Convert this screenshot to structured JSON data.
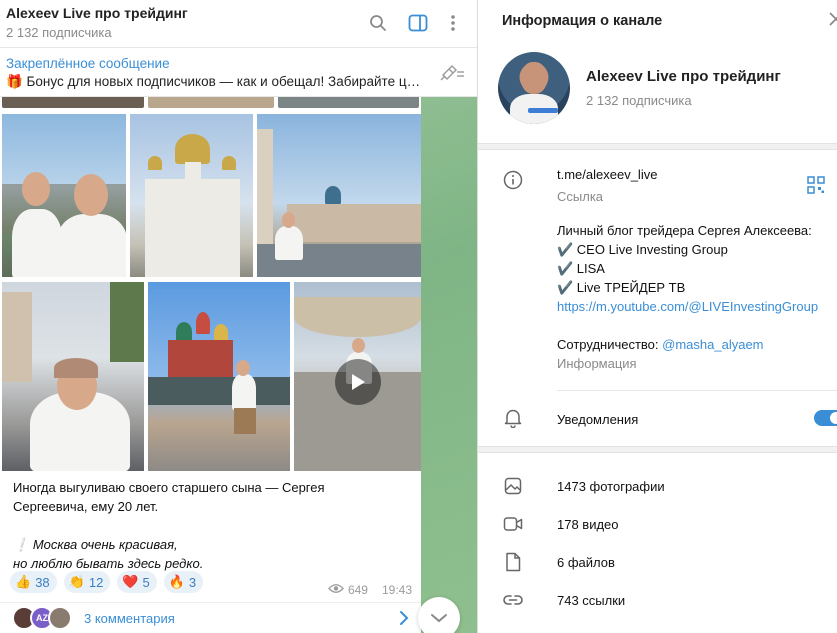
{
  "chat": {
    "title": "Alexeev Live про трейдинг",
    "subscribers": "2 132 подписчика",
    "pinned": {
      "title": "Закреплённое сообщение",
      "text": "🎁 Бонус для новых подписчиков — как и обещал! Забирайте ц…"
    },
    "message": {
      "caption_line1": "Иногда выгуливаю своего старшего сына — Сергея",
      "caption_line2": "Сергеевича, ему 20 лет.",
      "quote_mark": "❕",
      "italic_line1": "Москва очень красивая,",
      "italic_line2": "но люблю бывать здесь редко.",
      "reactions": [
        {
          "emoji": "👍",
          "count": "38"
        },
        {
          "emoji": "👏",
          "count": "12"
        },
        {
          "emoji": "❤️",
          "count": "5"
        },
        {
          "emoji": "🔥",
          "count": "3"
        }
      ],
      "views": "649",
      "time": "19:43",
      "comments_label": "3 комментария",
      "commenter_initials": "AZ"
    }
  },
  "info": {
    "header_title": "Информация о канале",
    "name": "Alexeev Live про трейдинг",
    "subscribers": "2 132 подписчика",
    "link": "t.me/alexeev_live",
    "link_label": "Ссылка",
    "desc_line1": "Личный блог трейдера Сергея Алексеева:",
    "desc_line2": "✔️ CEO Live Investing Group",
    "desc_line3": "✔️ LISA",
    "desc_line4": "✔️ Live ТРЕЙДЕР ТВ",
    "desc_url": "https://m.youtube.com/@LIVEInvestingGroup",
    "coop_prefix": "Сотрудничество:",
    "coop_handle": "@masha_alyaem",
    "desc_label": "Информация",
    "notifications": "Уведомления",
    "media": [
      {
        "icon": "photo-icon",
        "label": "1473 фотографии"
      },
      {
        "icon": "video-icon",
        "label": "178 видео"
      },
      {
        "icon": "file-icon",
        "label": "6 файлов"
      },
      {
        "icon": "link-icon",
        "label": "743 ссылки"
      }
    ]
  },
  "colors": {
    "accent": "#3a8ed6",
    "wallpaper": "#8fbf8e"
  }
}
